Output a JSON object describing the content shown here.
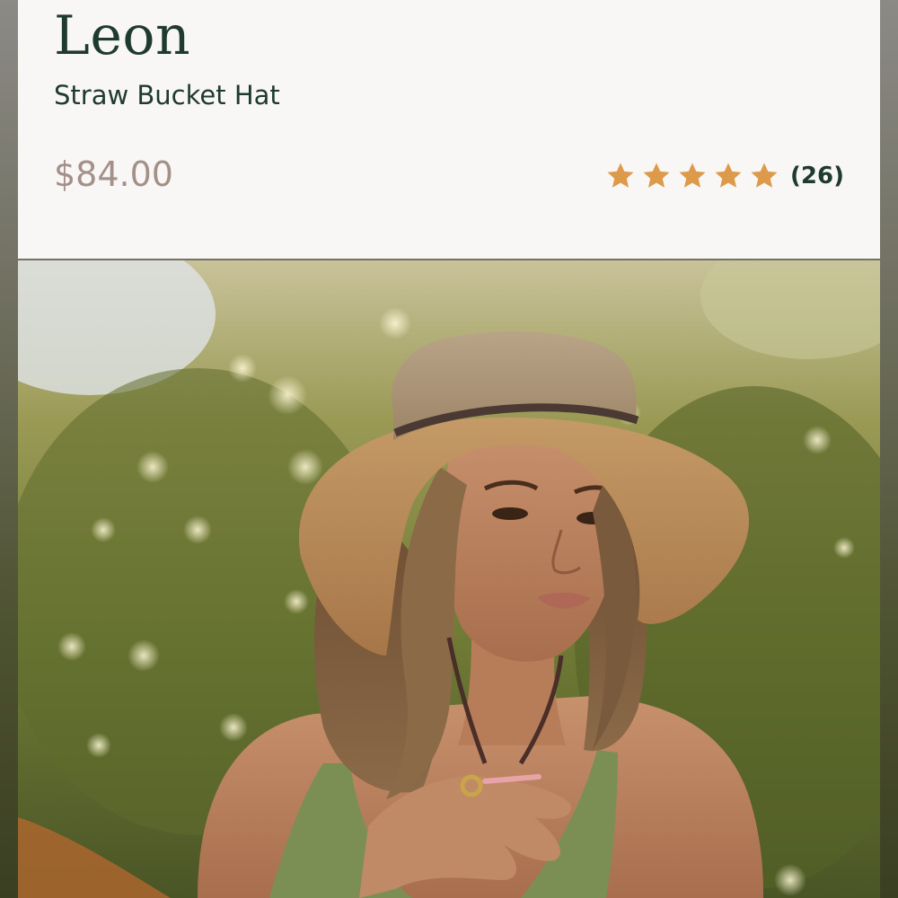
{
  "product": {
    "name": "Leon",
    "subtitle": "Straw Bucket Hat",
    "price": "$84.00",
    "rating": {
      "stars": 5,
      "max_stars": 5,
      "count_label": "(26)",
      "star_color": "#dd9a4a"
    }
  },
  "image": {
    "icon": "product-photo",
    "description_alt": ""
  },
  "colors": {
    "title": "#1f3a30",
    "price": "#a39088",
    "card_background": "#f8f7f5"
  }
}
